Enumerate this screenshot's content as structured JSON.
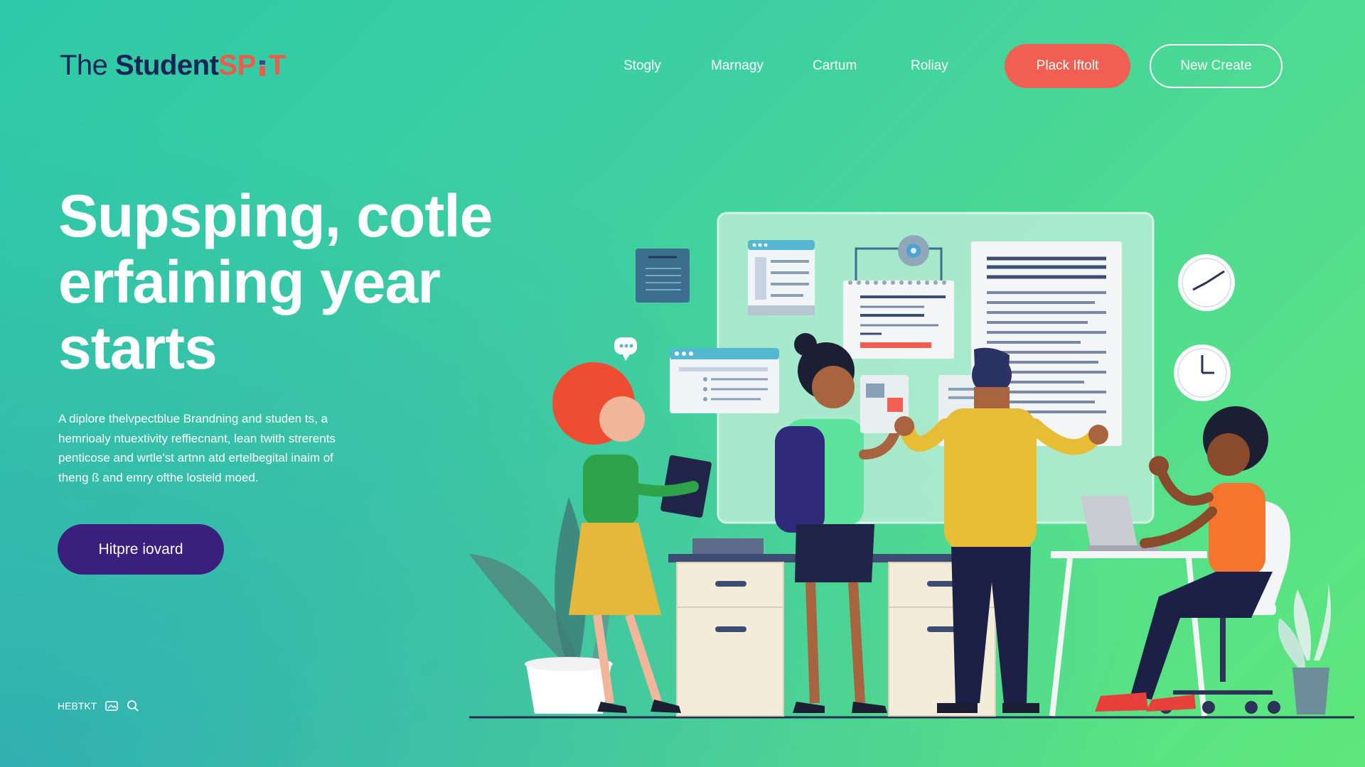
{
  "brand": {
    "part1": "The ",
    "part2": "Student",
    "part3": "SP",
    "part4": "T",
    "accent_color": "#ef5b48",
    "dark_color": "#1b2454"
  },
  "nav": {
    "items": [
      {
        "label": "Stogly"
      },
      {
        "label": "Marnagy"
      },
      {
        "label": "Cartum"
      },
      {
        "label": "Roliay"
      }
    ],
    "cta_primary": "Plack Iftolt",
    "cta_secondary": "New Create"
  },
  "hero": {
    "title_line1": "Supsping, cotle",
    "title_line2": "erfaining year",
    "title_line3": "starts",
    "description_line1": "A diplore thelvpectblue Brandning and studen ts, a",
    "description_line2": "hemrioaly ntuextivity reffiecnant, lean twith strerents",
    "description_line3": "penticose and wrtle'st artnn atd ertelbegital inaim of",
    "description_line4": "theng ß and emry ofthe losteld moed.",
    "button_label": "Hitpre iovard"
  },
  "footer": {
    "label": "HEBTKT",
    "icons": [
      "image-icon",
      "search-icon"
    ]
  },
  "colors": {
    "coral": "#f15e52",
    "purple": "#3a1f7d",
    "bg_start": "#2dc9a8",
    "bg_end": "#5ee77b"
  }
}
